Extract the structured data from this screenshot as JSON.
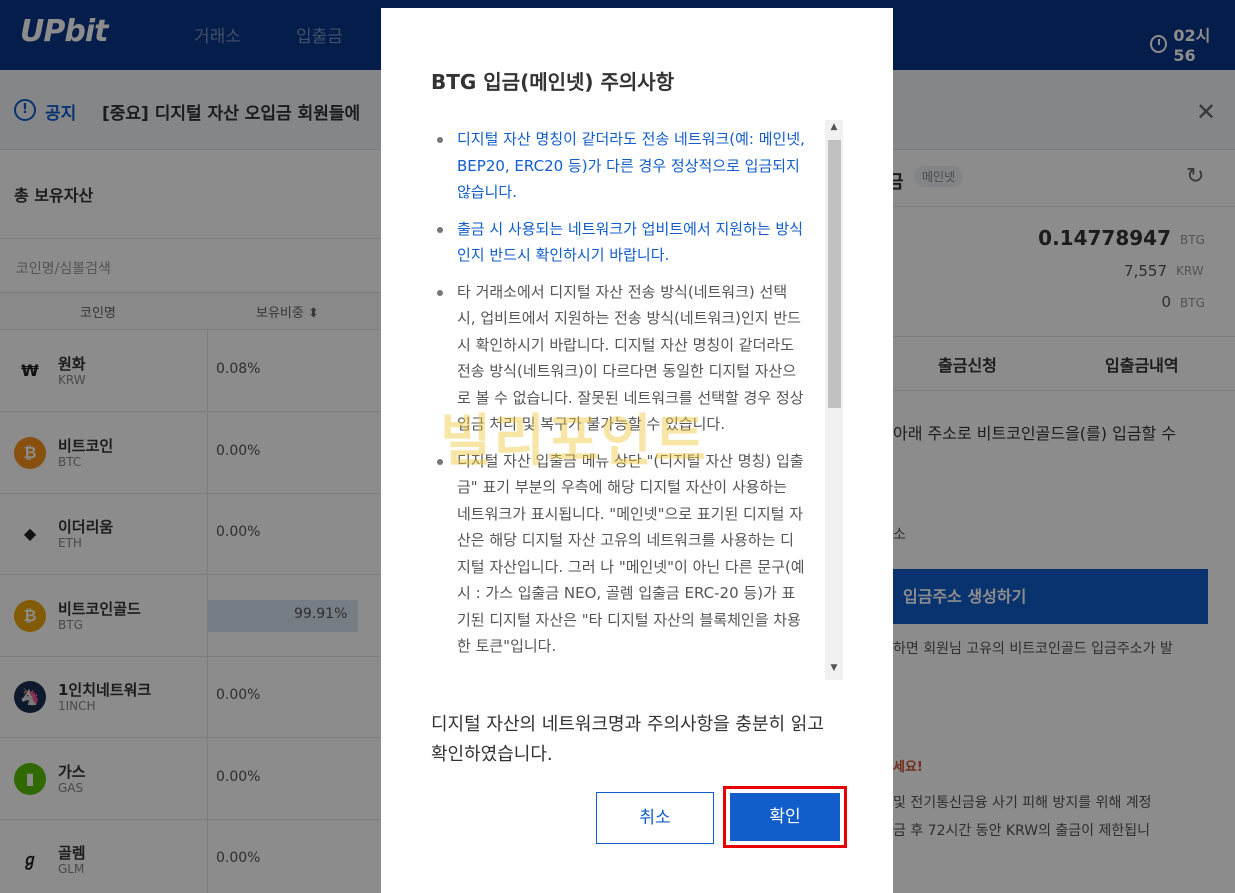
{
  "header": {
    "logo": "UPbit",
    "nav": [
      "거래소",
      "입출금"
    ],
    "clock": "02시 56"
  },
  "notice": {
    "label": "공지",
    "text": "[중요] 디지털 자산 오입금 회원들에"
  },
  "left_panel": {
    "total_title": "총 보유자산",
    "search_placeholder": "코인명/심볼검색",
    "col_coin": "코인명",
    "col_ratio": "보유비중 ⬍",
    "coins": [
      {
        "name": "원화",
        "symbol": "KRW",
        "pct": "0.08%",
        "icon": "won-icon",
        "color": "#ffffff",
        "glyph": "₩"
      },
      {
        "name": "비트코인",
        "symbol": "BTC",
        "pct": "0.00%",
        "icon": "bitcoin-icon",
        "color": "#f7931a",
        "glyph": "₿"
      },
      {
        "name": "이더리움",
        "symbol": "ETH",
        "pct": "0.00%",
        "icon": "ethereum-icon",
        "color": "#ffffff",
        "glyph": "◆"
      },
      {
        "name": "비트코인골드",
        "symbol": "BTG",
        "pct": "99.91%",
        "icon": "bitcoin-gold-icon",
        "color": "#eba809",
        "glyph": "₿",
        "fill": 0.9991
      },
      {
        "name": "1인치네트워크",
        "symbol": "1INCH",
        "pct": "0.00%",
        "icon": "1inch-icon",
        "color": "#1b314f",
        "glyph": "🦄"
      },
      {
        "name": "가스",
        "symbol": "GAS",
        "pct": "0.00%",
        "icon": "gas-icon",
        "color": "#58bf00",
        "glyph": "▮"
      },
      {
        "name": "골렘",
        "symbol": "GLM",
        "pct": "0.00%",
        "icon": "golem-icon",
        "color": "#ffffff",
        "glyph": "ℊ"
      }
    ]
  },
  "right_panel": {
    "title": "금",
    "badge": "메인넷",
    "amount_main": "0.14778947",
    "amount_main_unit": "BTG",
    "amount_krw": "7,557",
    "amount_krw_unit": "KRW",
    "amount_zero": "0",
    "amount_zero_unit": "BTG",
    "tab_withdraw": "출금신청",
    "tab_history": "입출금내역",
    "deposit_text": "아래 주소로 비트코인골드을(를) 입금할 수",
    "address_label": "소",
    "create_button": "입금주소 생성하기",
    "create_desc": "하면 회원님 고유의 비트코인골드 입금주소가 발",
    "warn_title": "세요!",
    "warn_line1": "및 전기통신금융 사기 피해 방지를 위해 계정",
    "warn_line2": "금 후 72시간 동안 KRW의 출금이 제한됩니"
  },
  "modal": {
    "title": "BTG 입금(메인넷) 주의사항",
    "items": [
      "디지털 자산 명칭이 같더라도 전송 네트워크(예: 메인넷, BEP20, ERC20 등)가 다른 경우 정상적으로 입금되지 않습니다.",
      "출금 시 사용되는 네트워크가 업비트에서 지원하는 방식인지 반드시 확인하시기 바랍니다.",
      "타 거래소에서 디지털 자산 전송 방식(네트워크) 선택 시, 업비트에서 지원하는 전송 방식(네트워크)인지 반드시 확인하시기 바랍니다. 디지털 자산 명칭이 같더라도 전송 방식(네트워크)이 다르다면 동일한 디지털 자산으로 볼 수 없습니다. 잘못된 네트워크를 선택할 경우 정상 입금 처리 및 복구가 불가능할 수 있습니다.",
      "디지털 자산 입출금 메뉴 상단 \"(디지털 자산 명칭) 입출금\" 표기 부분의 우측에 해당 디지털 자산이 사용하는 네트워크가 표시됩니다. \"메인넷\"으로 표기된 디지털 자산은 해당 디지털 자산 고유의 네트워크를 사용하는 디지털 자산입니다. 그러 나 \"메인넷\"이 아닌 다른 문구(예시 : 가스 입출금 NEO, 골렘 입출금 ERC-20 등)가 표기된 디지털 자산은 \"타 디지털 자산의 블록체인을 차용한 토큰\"입니다."
    ],
    "confirm_text": "디지털 자산의 네트워크명과 주의사항을 충분히 읽고 확인하였습니다.",
    "cancel": "취소",
    "ok": "확인"
  },
  "watermark": "빌리포인트"
}
